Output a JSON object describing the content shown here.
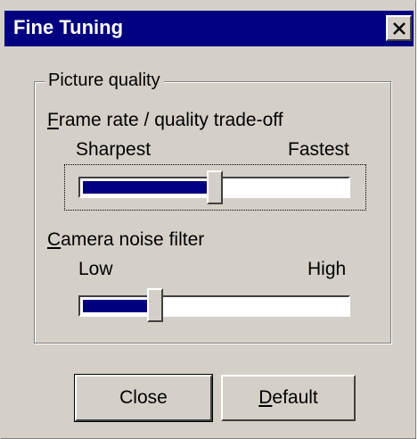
{
  "window": {
    "title": "Fine Tuning",
    "close_glyph": "✕",
    "titlebar_color": "#000080"
  },
  "group": {
    "title": "Picture quality"
  },
  "frame_rate": {
    "label_access": "F",
    "label_rest": "rame rate / quality trade-off",
    "min_label": "Sharpest",
    "max_label": "Fastest",
    "value": 0.5
  },
  "noise_filter": {
    "label_access": "C",
    "label_rest": "amera noise filter",
    "min_label": "Low",
    "max_label": "High",
    "value": 0.27
  },
  "buttons": {
    "close_label": "Close",
    "default_access": "D",
    "default_rest": "efault"
  },
  "colors": {
    "slider_fill": "#000080",
    "face": "#d4d0c8"
  }
}
